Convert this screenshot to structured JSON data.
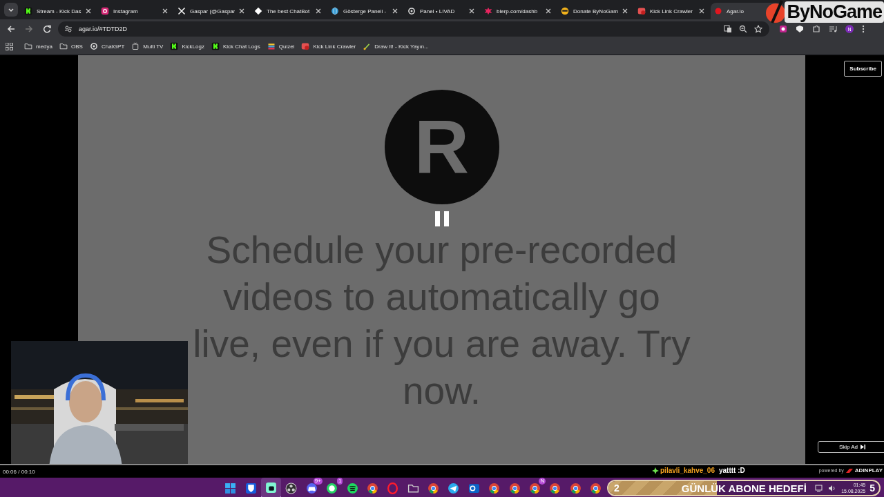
{
  "browser": {
    "tabs": [
      {
        "title": "Stream - Kick Das",
        "kind": "kick",
        "selected": false
      },
      {
        "title": "Instagram",
        "kind": "instagram",
        "selected": false
      },
      {
        "title": "Gaspar (@Gaspar",
        "kind": "x",
        "selected": false
      },
      {
        "title": "The best ChatBot",
        "kind": "diamond",
        "selected": false
      },
      {
        "title": "Gösterge Paneli -",
        "kind": "globe",
        "selected": false
      },
      {
        "title": "Panel • LIVAD",
        "kind": "ring",
        "selected": false
      },
      {
        "title": "blerp.com/dashb",
        "kind": "blerp",
        "selected": false
      },
      {
        "title": "Donate ByNoGam",
        "kind": "avatar",
        "selected": false
      },
      {
        "title": "Kick Link Crawler",
        "kind": "crawler",
        "selected": false
      },
      {
        "title": "Agar.io",
        "kind": "agar",
        "selected": true
      }
    ],
    "address": "agar.io/#TDTD2D",
    "profile": "N",
    "bookmarks": [
      {
        "label": "medya",
        "kind": "folder"
      },
      {
        "label": "OBS",
        "kind": "folder"
      },
      {
        "label": "ChatGPT",
        "kind": "ring"
      },
      {
        "label": "Multi TV",
        "kind": "tv"
      },
      {
        "label": "KickLogz",
        "kind": "kick"
      },
      {
        "label": "Kick Chat Logs",
        "kind": "kick"
      },
      {
        "label": "Quizei",
        "kind": "quiz"
      },
      {
        "label": "Kick Link Crawler",
        "kind": "crawler"
      },
      {
        "label": "Draw It! - Kick Yayın...",
        "kind": "draw"
      }
    ]
  },
  "ad": {
    "logo_letter": "R",
    "message": "Schedule your pre-recorded videos to automatically go live, even if you are away. Try now.",
    "paused": true,
    "subscribe": "Subscribe",
    "skip": "Skip Ad",
    "time": "00:06 / 00:10",
    "powered_by": "powered by",
    "brand": "ADINPLAY"
  },
  "chat": {
    "user": "pilavli_kahve_06",
    "message": "yatttt :D"
  },
  "overlay_logo": "ByNoGame",
  "goal": {
    "current": "2",
    "title": "GÜNLÜK ABONE HEDEFİ",
    "target": "5",
    "level": 0.4
  },
  "taskbar": {
    "apps": [
      {
        "kind": "windows",
        "active": false
      },
      {
        "kind": "shield",
        "active": false
      },
      {
        "kind": "streamlabs",
        "active": true
      },
      {
        "kind": "obs",
        "active": false
      },
      {
        "kind": "discord",
        "active": false,
        "badge": "9+"
      },
      {
        "kind": "whatsapp",
        "active": false,
        "badge": "1"
      },
      {
        "kind": "spotify",
        "active": false
      },
      {
        "kind": "chrome",
        "active": false
      },
      {
        "kind": "opera",
        "active": false
      },
      {
        "kind": "folder",
        "active": false
      },
      {
        "kind": "chrome",
        "active": false
      },
      {
        "kind": "telegram",
        "active": false
      },
      {
        "kind": "outlook",
        "active": false
      },
      {
        "kind": "chrome",
        "active": false
      },
      {
        "kind": "chrome",
        "active": false
      },
      {
        "kind": "chrome",
        "active": false,
        "badge": "N"
      },
      {
        "kind": "chrome",
        "active": false
      },
      {
        "kind": "chrome",
        "active": false
      },
      {
        "kind": "chrome",
        "active": false
      }
    ],
    "time": "01:45",
    "date": "15.08.2025"
  }
}
